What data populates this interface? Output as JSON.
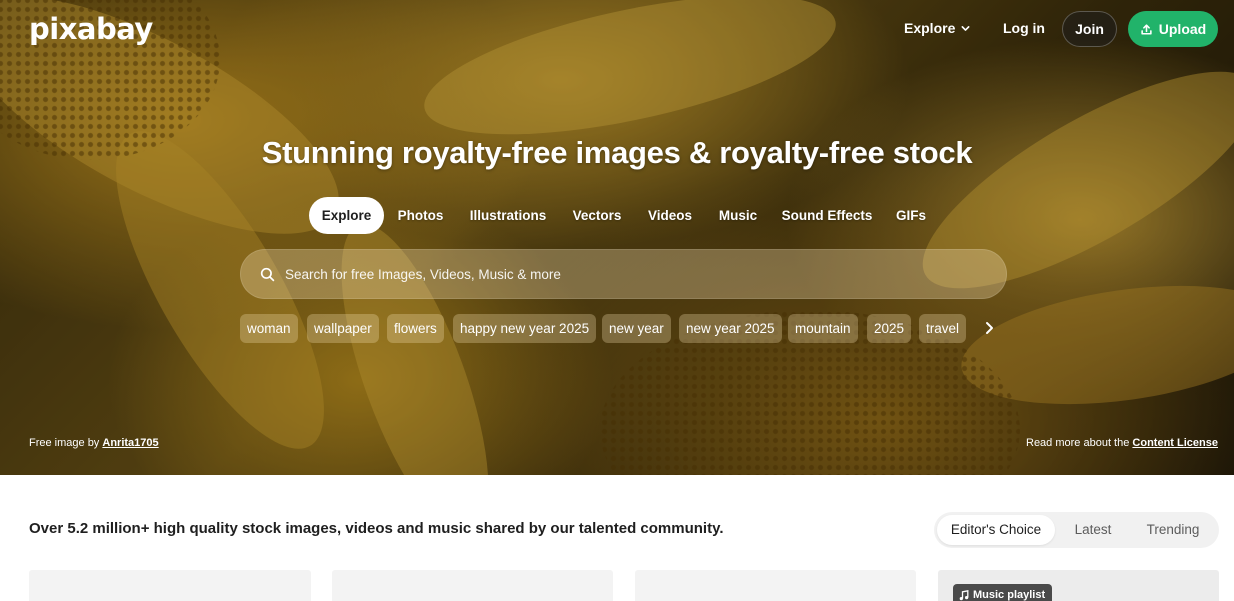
{
  "header": {
    "logo": "pixabay",
    "explore_label": "Explore",
    "login_label": "Log in",
    "join_label": "Join",
    "upload_label": "Upload"
  },
  "hero": {
    "title": "Stunning royalty-free images & royalty-free stock",
    "tabs": [
      {
        "label": "Explore",
        "active": true
      },
      {
        "label": "Photos"
      },
      {
        "label": "Illustrations"
      },
      {
        "label": "Vectors"
      },
      {
        "label": "Videos"
      },
      {
        "label": "Music"
      },
      {
        "label": "Sound Effects"
      },
      {
        "label": "GIFs"
      }
    ],
    "search": {
      "placeholder": "Search for free Images, Videos, Music & more",
      "value": ""
    },
    "suggestions": [
      "woman",
      "wallpaper",
      "flowers",
      "happy new year 2025",
      "new year",
      "new year 2025",
      "mountain",
      "2025",
      "travel"
    ],
    "credit_prefix": "Free image by",
    "credit_author": "Anrita1705",
    "license_prefix": "Read more about the",
    "license_link": "Content License"
  },
  "main": {
    "tagline": "Over 5.2 million+ high quality stock images, videos and music shared by our talented community.",
    "sort_options": [
      {
        "label": "Editor's Choice",
        "active": true
      },
      {
        "label": "Latest"
      },
      {
        "label": "Trending"
      }
    ],
    "music_badge": "Music playlist"
  },
  "colors": {
    "accent": "#21b36a",
    "hero_overlay": "#6b5316"
  }
}
